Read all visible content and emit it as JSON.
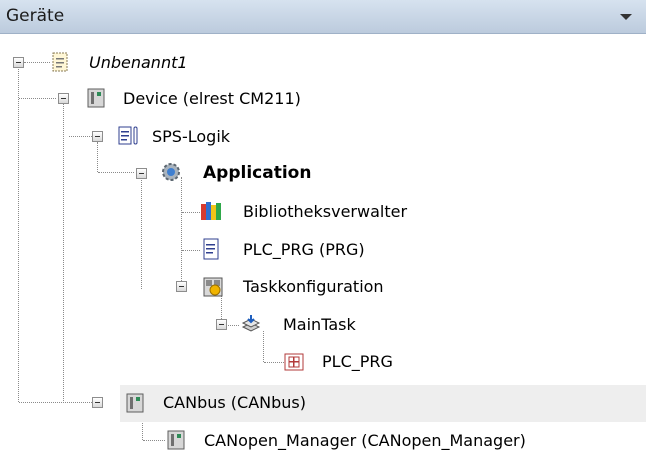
{
  "panel": {
    "title": "Geräte"
  },
  "tree": {
    "project": "Unbenannt1",
    "device": "Device (elrest CM211)",
    "plc_logic": "SPS-Logik",
    "application": "Application",
    "library_manager": "Bibliotheksverwalter",
    "plc_prg": "PLC_PRG (PRG)",
    "task_config": "Taskkonfiguration",
    "main_task": "MainTask",
    "plc_prg_call": "PLC_PRG",
    "canbus": "CANbus (CANbus)",
    "canopen_manager": "CANopen_Manager (CANopen_Manager)"
  }
}
